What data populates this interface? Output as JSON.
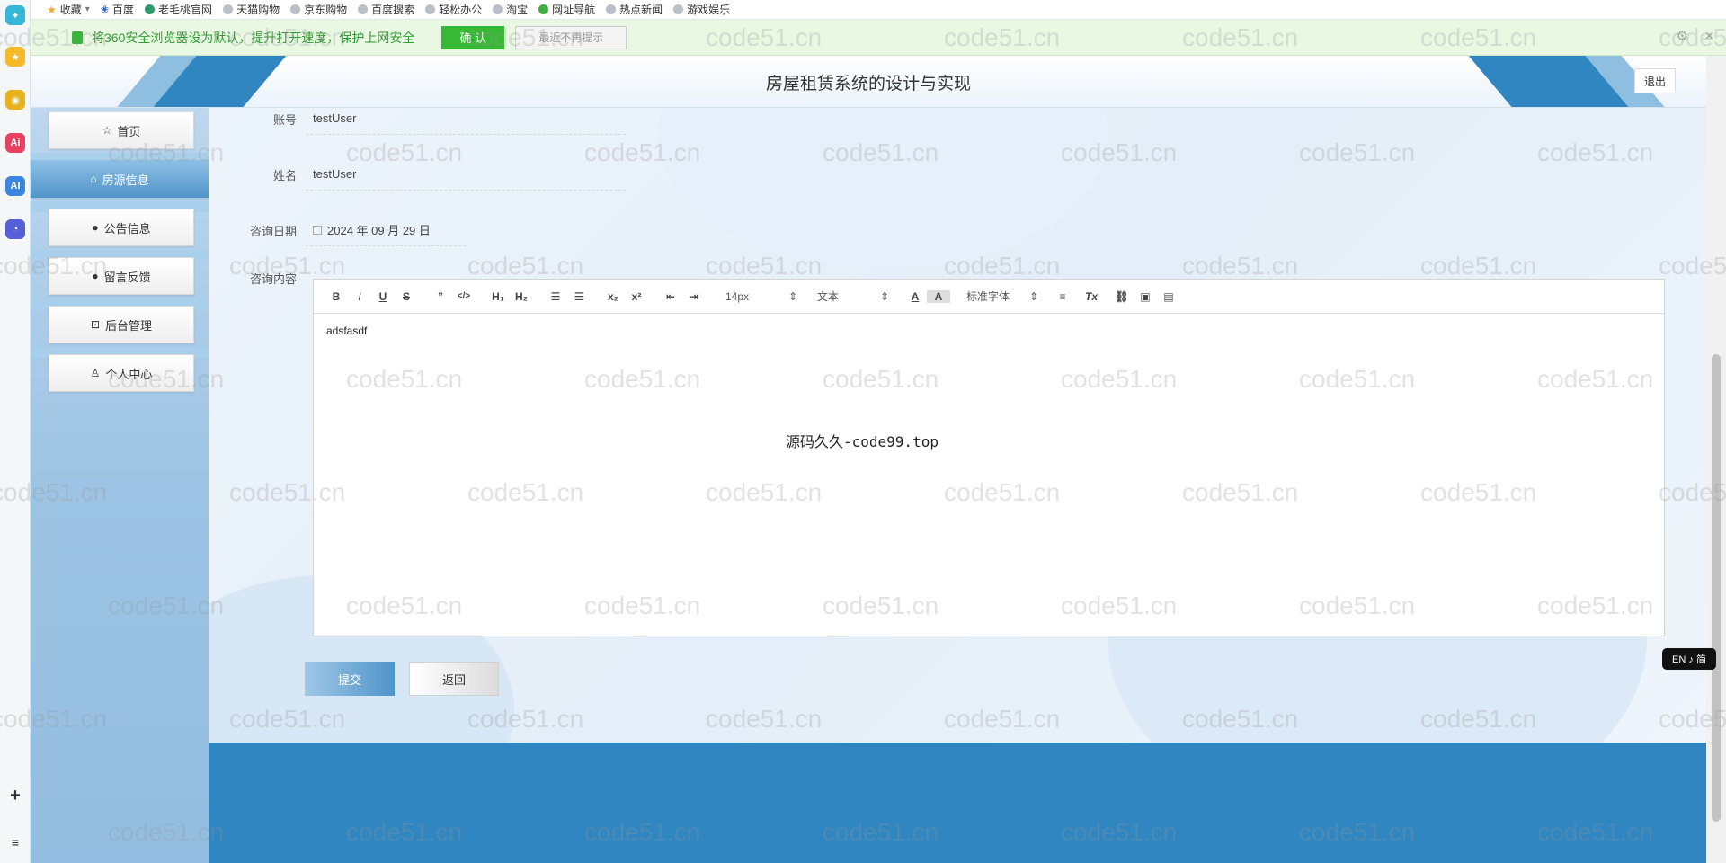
{
  "bookmarks": [
    "收藏",
    "百度",
    "老毛桃官网",
    "天猫购物",
    "京东购物",
    "百度搜索",
    "轻松办公",
    "淘宝",
    "网址导航",
    "热点新闻",
    "游戏娱乐"
  ],
  "notice": {
    "text": "将360安全浏览器设为默认，提升打开速度，保护上网安全",
    "confirm_label": "确 认",
    "later_label": "最近不再提示",
    "close_glyph": "×",
    "settings_glyph": "⚙"
  },
  "header": {
    "title": "房屋租赁系统的设计与实现",
    "logout_label": "退出"
  },
  "sidebar": {
    "items": [
      {
        "label": "首页",
        "icon_glyph": "☆",
        "icon": "star-icon"
      },
      {
        "label": "房源信息",
        "icon_glyph": "⌂",
        "icon": "house-icon",
        "active": true
      },
      {
        "label": "公告信息",
        "icon_glyph": "●",
        "icon": "notice-icon"
      },
      {
        "label": "留言反馈",
        "icon_glyph": "●",
        "icon": "question-icon"
      },
      {
        "label": "后台管理",
        "icon_glyph": "⊡",
        "icon": "lock-icon"
      },
      {
        "label": "个人中心",
        "icon_glyph": "♙",
        "icon": "user-icon"
      }
    ]
  },
  "form": {
    "account_label": "账号",
    "account_value": "testUser",
    "name_label": "姓名",
    "name_value": "testUser",
    "date_label": "咨询日期",
    "date_value": "2024 年 09 月 29 日",
    "content_label": "咨询内容"
  },
  "editor": {
    "font_size": "14px",
    "text_type": "文本",
    "font_family": "标准字体",
    "content": "adsfasdf"
  },
  "actions": {
    "submit_label": "提交",
    "back_label": "返回"
  },
  "overlay_note": "源码久久-code99.top",
  "lang_badge": "EN ♪ 简",
  "watermark": "code51.cn",
  "strip_icons": [
    "sidebar-logo-icon",
    "favorites-star-icon",
    "game-icon",
    "ai-icon",
    "ai-assistant-icon",
    "chat-bot-icon",
    "plus-icon",
    "list-icon"
  ],
  "colors": {
    "accent": "#2f86c0",
    "sidebar": "#9dc4e4",
    "active_menu": "#4f94c9",
    "notice_green": "#2f9a2f"
  }
}
